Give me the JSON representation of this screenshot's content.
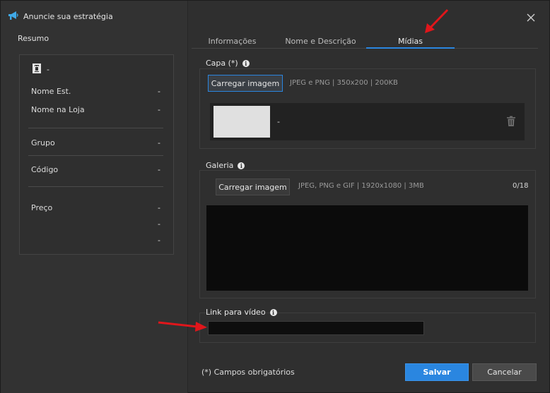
{
  "window": {
    "title": "Anuncie sua estratégia"
  },
  "summary": {
    "heading": "Resumo",
    "name_value": "-",
    "rows": [
      {
        "label": "Nome Est.",
        "value": "-"
      },
      {
        "label": "Nome na Loja",
        "value": "-"
      },
      {
        "label": "Grupo",
        "value": "-"
      },
      {
        "label": "Código",
        "value": "-"
      },
      {
        "label": "Preço",
        "value": "-"
      }
    ],
    "extra_values": [
      "-",
      "-"
    ]
  },
  "tabs": [
    {
      "label": "Informações",
      "active": false
    },
    {
      "label": "Nome e Descrição",
      "active": false
    },
    {
      "label": "Mídias",
      "active": true
    }
  ],
  "cover": {
    "label": "Capa (*)",
    "upload_label": "Carregar imagem",
    "hint": "JPEG e PNG | 350x200 | 200KB",
    "file_name": "-"
  },
  "gallery": {
    "label": "Galeria",
    "upload_label": "Carregar imagem",
    "hint": "JPEG, PNG e GIF | 1920x1080 | 3MB",
    "count": "0/18"
  },
  "video": {
    "label": "Link para vídeo",
    "value": ""
  },
  "footer": {
    "required_note": "(*) Campos obrigatórios",
    "save_label": "Salvar",
    "cancel_label": "Cancelar"
  },
  "colors": {
    "accent": "#2a86e0",
    "annotation_arrow": "#e0161b"
  }
}
